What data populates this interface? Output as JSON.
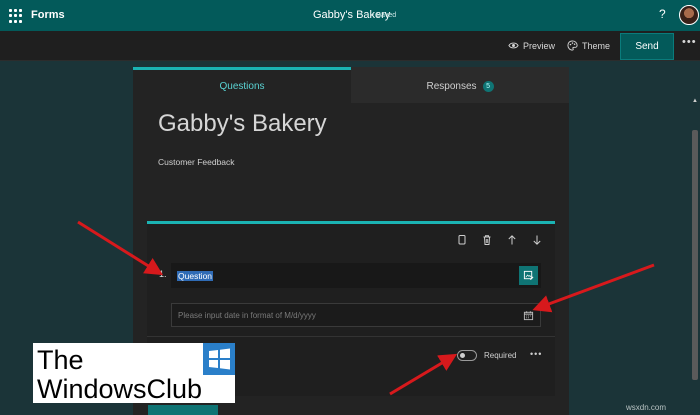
{
  "appbar": {
    "app_name": "Forms",
    "doc_title": "Gabby's Bakery",
    "doc_status": "- Saved",
    "help": "?"
  },
  "commands": {
    "preview": "Preview",
    "theme": "Theme",
    "send": "Send",
    "more": "•••"
  },
  "tabs": {
    "questions": "Questions",
    "responses": "Responses",
    "responses_count": "5"
  },
  "form": {
    "title": "Gabby's Bakery",
    "description": "Customer Feedback"
  },
  "question": {
    "number": "1.",
    "text": "Question",
    "date_placeholder": "Please input date in format of M/d/yyyy",
    "required_label": "Required",
    "more": "•••"
  },
  "watermark": {
    "line1": "The",
    "line2": "WindowsClub"
  },
  "credit": "wsxdn.com",
  "colors": {
    "brand": "#035a5a",
    "accent": "#1bb3b3",
    "annotation_arrow": "#d7191c"
  }
}
